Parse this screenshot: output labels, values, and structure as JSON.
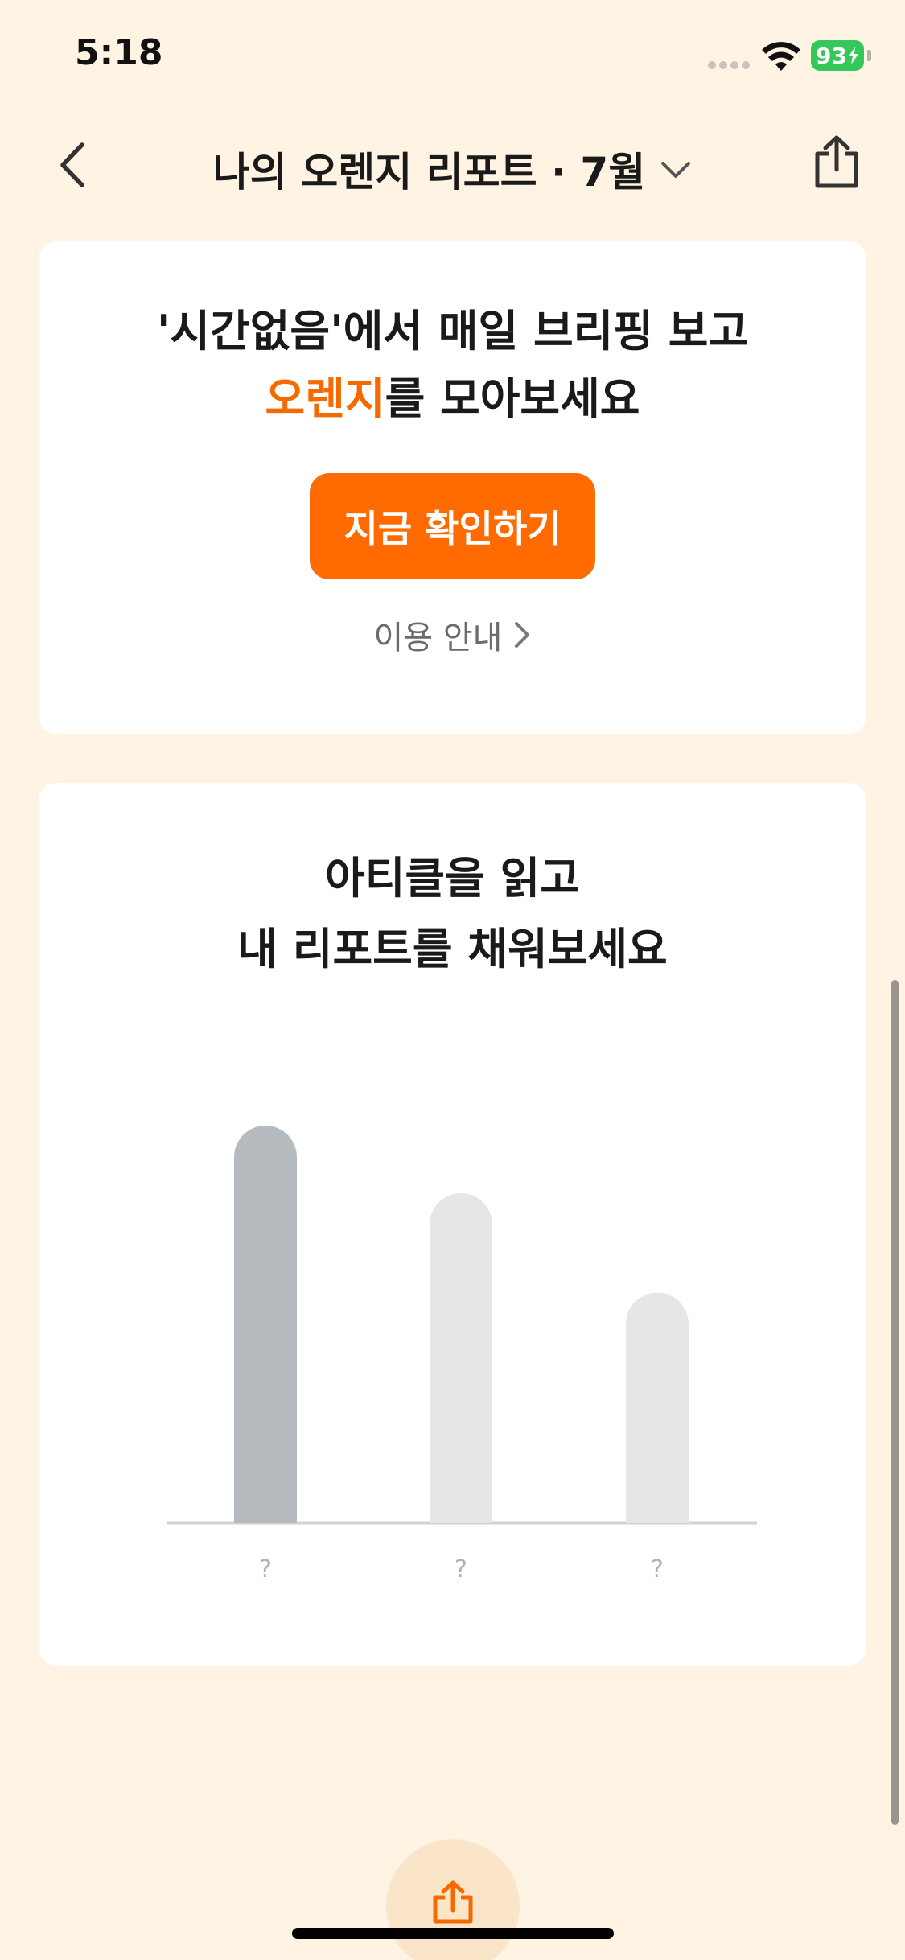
{
  "status_bar": {
    "time": "5:18",
    "battery": "93"
  },
  "header": {
    "title": "나의 오렌지 리포트 · 7월"
  },
  "promo": {
    "line1": "'시간없음'에서 매일 브리핑 보고",
    "line2_accent": "오렌지",
    "line2_rest": "를 모아보세요",
    "cta_label": "지금 확인하기",
    "guide_label": "이용 안내"
  },
  "report": {
    "title_line1": "아티클을 읽고",
    "title_line2": "내 리포트를 채워보세요"
  },
  "chart_data": {
    "type": "bar",
    "categories": [
      "?",
      "?",
      "?"
    ],
    "values": [
      100,
      83,
      58
    ],
    "ylim": [
      0,
      100
    ],
    "grid": false,
    "colors": [
      "#B6BBBF",
      "#E6E6E6",
      "#E6E6E6"
    ]
  },
  "colors": {
    "background": "#FFF3E4",
    "accent": "#FF6B00",
    "card": "#FFFFFF"
  },
  "icons": {
    "back": "chevron-left-icon",
    "dropdown": "chevron-down-icon",
    "share": "share-icon",
    "guide": "chevron-right-icon"
  }
}
